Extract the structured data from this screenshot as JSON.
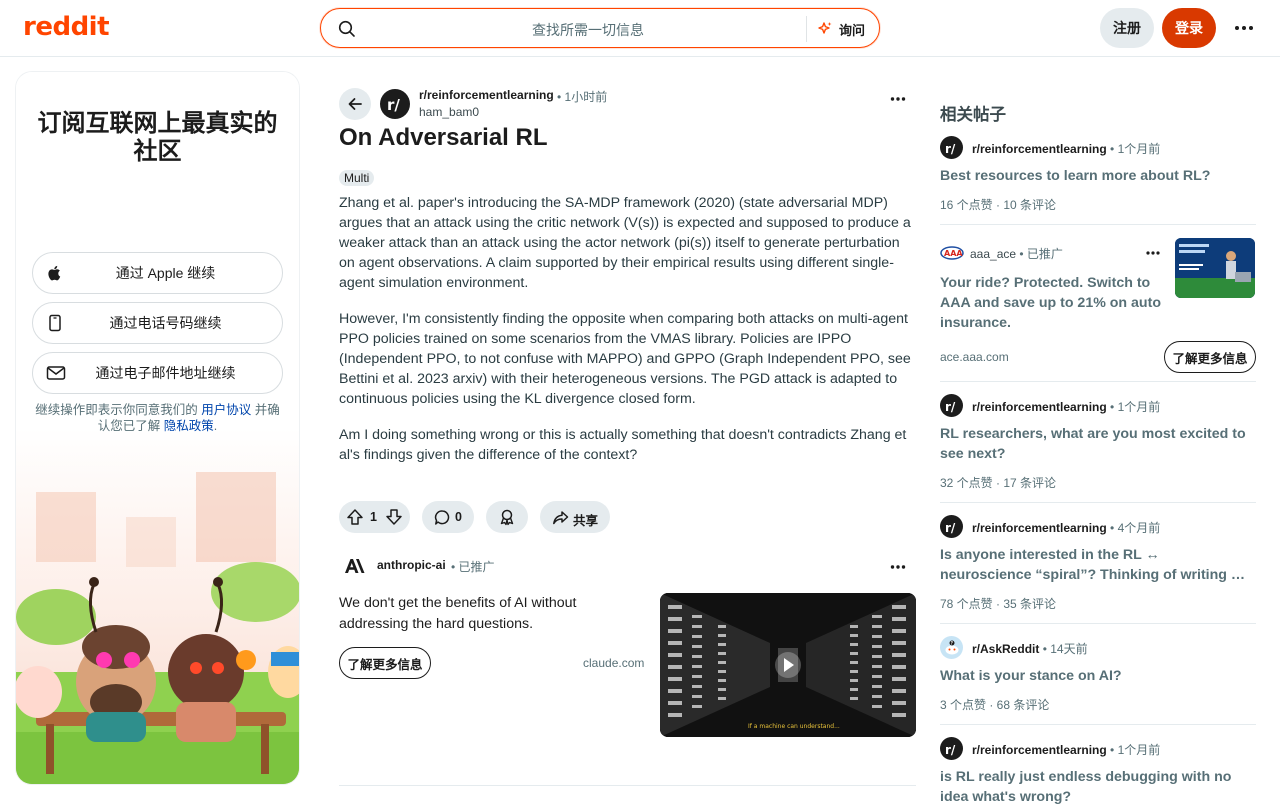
{
  "header": {
    "logo": "reddit",
    "search_placeholder": "查找所需一切信息",
    "ask_label": "询问",
    "signup_label": "注册",
    "login_label": "登录"
  },
  "left_panel": {
    "title": "订阅互联网上最真实的社区",
    "apple_label": "通过 Apple 继续",
    "phone_label": "通过电话号码继续",
    "email_label": "通过电子邮件地址继续",
    "terms_prefix": "继续操作即表示你同意我们的 ",
    "terms_link": "用户协议",
    "terms_mid": " 并确认您已了解 ",
    "privacy_link": "隐私政策",
    "terms_suffix": "."
  },
  "post": {
    "subreddit": "r/reinforcementlearning",
    "time": "• 1小时前",
    "author": "ham_bam0",
    "title": "On Adversarial RL",
    "flair": "Multi",
    "paragraphs": [
      "Zhang et al. paper's introducing the SA-MDP framework (2020) (state adversarial MDP) argues that an attack using the critic network (V(s)) is expected and supposed to produce a weaker attack than an attack using the actor network (pi(s)) itself to generate perturbation on agent observations. A claim supported by their empirical results using different single-agent simulation environment.",
      "However, I'm consistently finding the opposite when comparing both attacks on multi-agent PPO policies trained on some scenarios from the VMAS library. Policies are IPPO (Independent PPO, to not confuse with MAPPO) and GPPO (Graph Independent PPO, see Bettini et al. 2023 arxiv) with their heterogeneous versions. The PGD attack is adapted to continuous policies using the KL divergence closed form.",
      "Am I doing something wrong or this is actually something that doesn't contradicts Zhang et al's findings given the difference of the context?"
    ],
    "votes": "1",
    "comments": "0",
    "share_label": "共享"
  },
  "ad": {
    "name": "anthropic-ai",
    "tag": "• 已推广",
    "text": "We don't get the benefits of AI without addressing the hard questions.",
    "button": "了解更多信息",
    "domain": "claude.com",
    "image_caption": "If a machine can understand..."
  },
  "related": {
    "heading": "相关帖子",
    "items": [
      {
        "sub": "r/reinforcementlearning",
        "time": "• 1个月前",
        "title": "Best resources to learn more about RL?",
        "meta": "16 个点赞 · 10 条评论"
      },
      {
        "sub": "r/reinforcementlearning",
        "time": "• 1个月前",
        "title": "RL researchers, what are you most excited to see next?",
        "meta": "32 个点赞 · 17 条评论"
      },
      {
        "sub": "r/reinforcementlearning",
        "time": "• 4个月前",
        "title": "Is anyone interested in the RL ↔ neuroscience “spiral”? Thinking of writing a short series on it",
        "meta": "78 个点赞 · 35 条评论"
      },
      {
        "sub": "r/AskReddit",
        "time": "• 14天前",
        "title": "What is your stance on AI?",
        "meta": "3 个点赞 · 68 条评论"
      },
      {
        "sub": "r/reinforcementlearning",
        "time": "• 1个月前",
        "title": "is RL really just endless debugging with no idea what's wrong?",
        "meta": ""
      }
    ],
    "ad": {
      "name": "aaa_ace",
      "tag": "• 已推广",
      "title": "Your ride? Protected. Switch to AAA and save up to 21% on auto insurance.",
      "domain": "ace.aaa.com",
      "button": "了解更多信息"
    }
  }
}
